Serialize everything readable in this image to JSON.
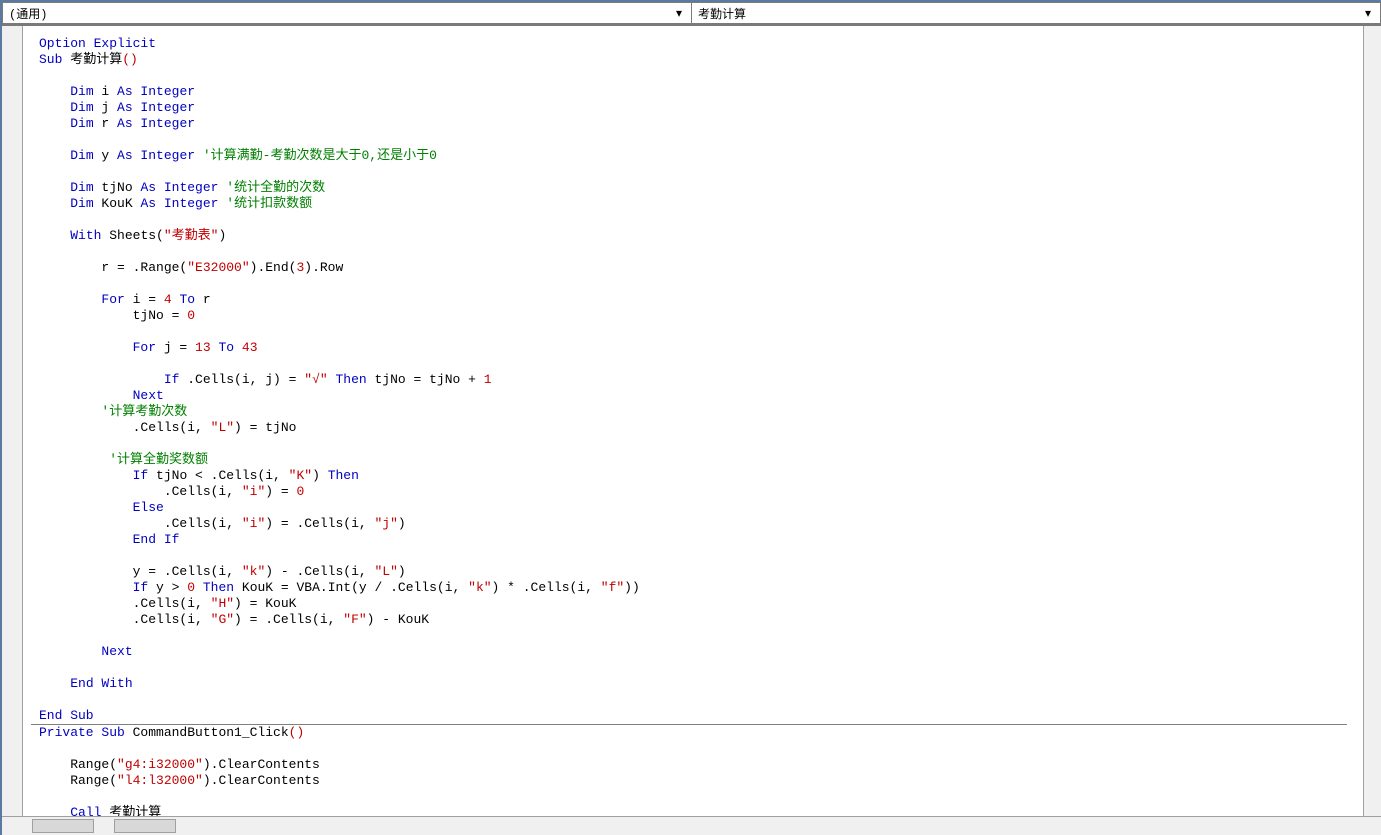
{
  "header": {
    "object_dropdown": "(通用)",
    "procedure_dropdown": "考勤计算"
  },
  "code": {
    "tokens": [
      [
        [
          "kw",
          "Option Explicit"
        ]
      ],
      [
        [
          "kw",
          "Sub"
        ],
        [
          "",
          " 考勤计算"
        ],
        [
          "str",
          "()"
        ]
      ],
      [],
      [
        [
          "",
          "    "
        ],
        [
          "kw",
          "Dim"
        ],
        [
          "",
          " i "
        ],
        [
          "kw",
          "As Integer"
        ]
      ],
      [
        [
          "",
          "    "
        ],
        [
          "kw",
          "Dim"
        ],
        [
          "",
          " j "
        ],
        [
          "kw",
          "As Integer"
        ]
      ],
      [
        [
          "",
          "    "
        ],
        [
          "kw",
          "Dim"
        ],
        [
          "",
          " r "
        ],
        [
          "kw",
          "As Integer"
        ]
      ],
      [],
      [
        [
          "",
          "    "
        ],
        [
          "kw",
          "Dim"
        ],
        [
          "",
          " y "
        ],
        [
          "kw",
          "As Integer"
        ],
        [
          "",
          " "
        ],
        [
          "cmt",
          "'计算满勤-考勤次数是大于0,还是小于0"
        ]
      ],
      [],
      [
        [
          "",
          "    "
        ],
        [
          "kw",
          "Dim"
        ],
        [
          "",
          " tjNo "
        ],
        [
          "kw",
          "As Integer"
        ],
        [
          "",
          " "
        ],
        [
          "cmt",
          "'统计全勤的次数"
        ]
      ],
      [
        [
          "",
          "    "
        ],
        [
          "kw",
          "Dim"
        ],
        [
          "",
          " KouK "
        ],
        [
          "kw",
          "As Integer"
        ],
        [
          "",
          " "
        ],
        [
          "cmt",
          "'统计扣款数额"
        ]
      ],
      [],
      [
        [
          "",
          "    "
        ],
        [
          "kw",
          "With"
        ],
        [
          "",
          " Sheets("
        ],
        [
          "str",
          "\"考勤表\""
        ],
        [
          "",
          ")"
        ]
      ],
      [],
      [
        [
          "",
          "        r = .Range("
        ],
        [
          "str",
          "\"E32000\""
        ],
        [
          "",
          ").End("
        ],
        [
          "str",
          "3"
        ],
        [
          "",
          ").Row"
        ]
      ],
      [],
      [
        [
          "",
          "        "
        ],
        [
          "kw",
          "For"
        ],
        [
          "",
          " i = "
        ],
        [
          "str",
          "4"
        ],
        [
          "",
          " "
        ],
        [
          "kw",
          "To"
        ],
        [
          "",
          " r"
        ]
      ],
      [
        [
          "",
          "            tjNo = "
        ],
        [
          "str",
          "0"
        ]
      ],
      [],
      [
        [
          "",
          "            "
        ],
        [
          "kw",
          "For"
        ],
        [
          "",
          " j = "
        ],
        [
          "str",
          "13"
        ],
        [
          "",
          " "
        ],
        [
          "kw",
          "To"
        ],
        [
          "",
          " "
        ],
        [
          "str",
          "43"
        ]
      ],
      [],
      [
        [
          "",
          "                "
        ],
        [
          "kw",
          "If"
        ],
        [
          "",
          " .Cells(i, j) = "
        ],
        [
          "str",
          "\"√\""
        ],
        [
          "",
          " "
        ],
        [
          "kw",
          "Then"
        ],
        [
          "",
          " tjNo = tjNo + "
        ],
        [
          "str",
          "1"
        ]
      ],
      [
        [
          "",
          "            "
        ],
        [
          "kw",
          "Next"
        ]
      ],
      [
        [
          "",
          "        "
        ],
        [
          "cmt",
          "'计算考勤次数"
        ]
      ],
      [
        [
          "",
          "            .Cells(i, "
        ],
        [
          "str",
          "\"L\""
        ],
        [
          "",
          ") = tjNo"
        ]
      ],
      [],
      [
        [
          "",
          "         "
        ],
        [
          "cmt",
          "'计算全勤奖数额"
        ]
      ],
      [
        [
          "",
          "            "
        ],
        [
          "kw",
          "If"
        ],
        [
          "",
          " tjNo < .Cells(i, "
        ],
        [
          "str",
          "\"K\""
        ],
        [
          "",
          ") "
        ],
        [
          "kw",
          "Then"
        ]
      ],
      [
        [
          "",
          "                .Cells(i, "
        ],
        [
          "str",
          "\"i\""
        ],
        [
          "",
          ") = "
        ],
        [
          "str",
          "0"
        ]
      ],
      [
        [
          "",
          "            "
        ],
        [
          "kw",
          "Else"
        ]
      ],
      [
        [
          "",
          "                .Cells(i, "
        ],
        [
          "str",
          "\"i\""
        ],
        [
          "",
          ") = .Cells(i, "
        ],
        [
          "str",
          "\"j\""
        ],
        [
          "",
          ")"
        ]
      ],
      [
        [
          "",
          "            "
        ],
        [
          "kw",
          "End If"
        ]
      ],
      [],
      [
        [
          "",
          "            y = .Cells(i, "
        ],
        [
          "str",
          "\"k\""
        ],
        [
          "",
          ") - .Cells(i, "
        ],
        [
          "str",
          "\"L\""
        ],
        [
          "",
          ")"
        ]
      ],
      [
        [
          "",
          "            "
        ],
        [
          "kw",
          "If"
        ],
        [
          "",
          " y > "
        ],
        [
          "str",
          "0"
        ],
        [
          "",
          " "
        ],
        [
          "kw",
          "Then"
        ],
        [
          "",
          " KouK = VBA.Int(y / .Cells(i, "
        ],
        [
          "str",
          "\"k\""
        ],
        [
          "",
          ") * .Cells(i, "
        ],
        [
          "str",
          "\"f\""
        ],
        [
          "",
          "))"
        ]
      ],
      [
        [
          "",
          "            .Cells(i, "
        ],
        [
          "str",
          "\"H\""
        ],
        [
          "",
          ") = KouK"
        ]
      ],
      [
        [
          "",
          "            .Cells(i, "
        ],
        [
          "str",
          "\"G\""
        ],
        [
          "",
          ") = .Cells(i, "
        ],
        [
          "str",
          "\"F\""
        ],
        [
          "",
          ") - KouK"
        ]
      ],
      [],
      [
        [
          "",
          "        "
        ],
        [
          "kw",
          "Next"
        ]
      ],
      [],
      [
        [
          "",
          "    "
        ],
        [
          "kw",
          "End With"
        ]
      ],
      [],
      [
        [
          "kw",
          "End Sub"
        ]
      ],
      "HR",
      [
        [
          "kw",
          "Private Sub"
        ],
        [
          "",
          " CommandButton1_Click"
        ],
        [
          "str",
          "()"
        ]
      ],
      [],
      [
        [
          "",
          "    Range("
        ],
        [
          "str",
          "\"g4:i32000\""
        ],
        [
          "",
          ").ClearContents"
        ]
      ],
      [
        [
          "",
          "    Range("
        ],
        [
          "str",
          "\"l4:l32000\""
        ],
        [
          "",
          ").ClearContents"
        ]
      ],
      [],
      [
        [
          "",
          "    "
        ],
        [
          "kw",
          "Call"
        ],
        [
          "",
          " 考勤计算"
        ]
      ]
    ]
  }
}
